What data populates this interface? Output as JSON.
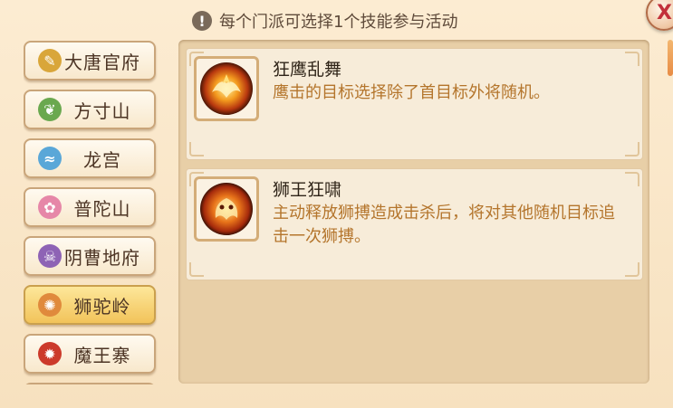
{
  "header": {
    "notice": "每个门派可选择1个技能参与活动",
    "warn_icon": "!",
    "close_icon": "X"
  },
  "sidebar": {
    "items": [
      {
        "label": "大唐官府",
        "icon": "sword-emblem-icon",
        "color": "#d9a63a",
        "glyph": "✎",
        "selected": false
      },
      {
        "label": "方寸山",
        "icon": "leaf-emblem-icon",
        "color": "#6aa84f",
        "glyph": "❦",
        "selected": false
      },
      {
        "label": "龙宫",
        "icon": "wave-emblem-icon",
        "color": "#5aa7d8",
        "glyph": "≈",
        "selected": false
      },
      {
        "label": "普陀山",
        "icon": "lotus-emblem-icon",
        "color": "#e687a8",
        "glyph": "✿",
        "selected": false
      },
      {
        "label": "阴曹地府",
        "icon": "skull-emblem-icon",
        "color": "#8e63b5",
        "glyph": "☠",
        "selected": false
      },
      {
        "label": "狮驼岭",
        "icon": "claw-emblem-icon",
        "color": "#e08a3c",
        "glyph": "✺",
        "selected": true
      },
      {
        "label": "魔王寨",
        "icon": "flame-emblem-icon",
        "color": "#cc3a2b",
        "glyph": "✹",
        "selected": false
      }
    ]
  },
  "skills": [
    {
      "name": "狂鹰乱舞",
      "desc": "鹰击的目标选择除了首目标外将随机。",
      "icon": "eagle-fire-skill-icon"
    },
    {
      "name": "狮王狂啸",
      "desc": "主动释放狮搏造成击杀后，将对其他随机目标追击一次狮搏。",
      "icon": "lion-roar-skill-icon"
    }
  ]
}
